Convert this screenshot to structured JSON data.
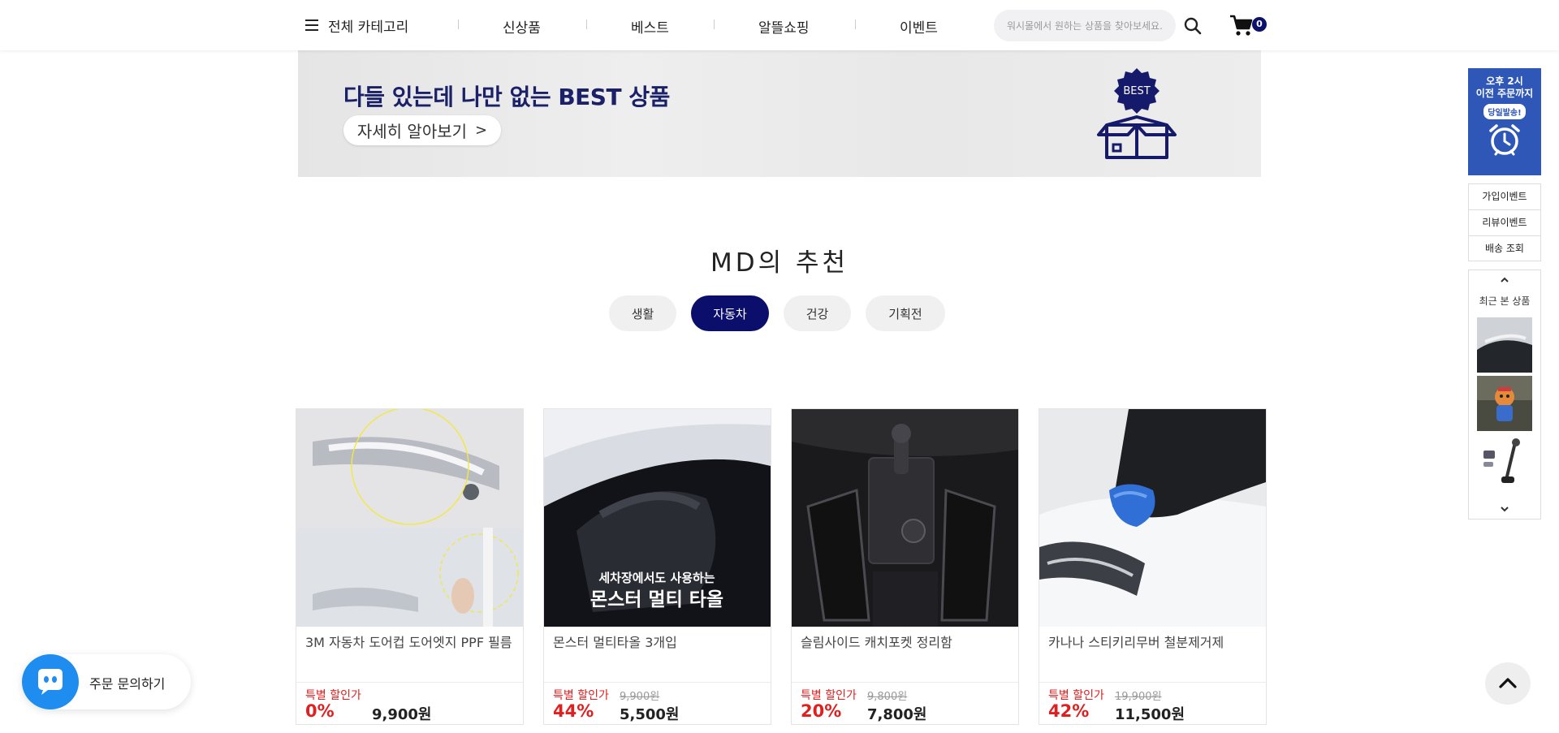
{
  "header": {
    "category_label": "전체 카테고리",
    "nav": [
      "신상품",
      "베스트",
      "알뜰쇼핑",
      "이벤트"
    ],
    "search_placeholder": "워시몰에서 원하는 상품을 찾아보세요.",
    "cart_count": "0"
  },
  "banner": {
    "title": "다들 있는데 나만 없는 BEST 상품",
    "button_label": "자세히 알아보기",
    "badge": "BEST"
  },
  "md_section": {
    "title": "MD의 추천",
    "tabs": [
      {
        "label": "생활",
        "active": false
      },
      {
        "label": "자동차",
        "active": true
      },
      {
        "label": "건강",
        "active": false
      },
      {
        "label": "기획전",
        "active": false
      }
    ]
  },
  "products": [
    {
      "name": "3M 자동차 도어컵 도어엣지 PPF 필름",
      "sale_label": "특별 할인가",
      "original_price": "",
      "discount": "0%",
      "price": "9,900원"
    },
    {
      "name": "몬스터 멀티타올 3개입",
      "sale_label": "특별 할인가",
      "original_price": "9,900원",
      "discount": "44%",
      "price": "5,500원",
      "image_text_1": "세차장에서도 사용하는",
      "image_text_2": "몬스터 멀티 타올"
    },
    {
      "name": "슬림사이드 캐치포켓 정리함",
      "sale_label": "특별 할인가",
      "original_price": "9,800원",
      "discount": "20%",
      "price": "7,800원"
    },
    {
      "name": "카나나 스티키리무버 철분제거제",
      "sale_label": "특별 할인가",
      "original_price": "19,900원",
      "discount": "42%",
      "price": "11,500원"
    }
  ],
  "sidebar": {
    "deadline_line1": "오후 2시",
    "deadline_line2": "이전 주문까지",
    "deadline_bubble": "당일발송!",
    "links": [
      "가입이벤트",
      "리뷰이벤트",
      "배송 조회"
    ],
    "recent_label": "최근 본 상품"
  },
  "chat": {
    "label": "주문 문의하기"
  },
  "colors": {
    "brand_navy": "#0b0f6b",
    "sale_red": "#e02020",
    "deadline_blue": "#2f57b8",
    "chat_blue": "#1f8cf0"
  }
}
